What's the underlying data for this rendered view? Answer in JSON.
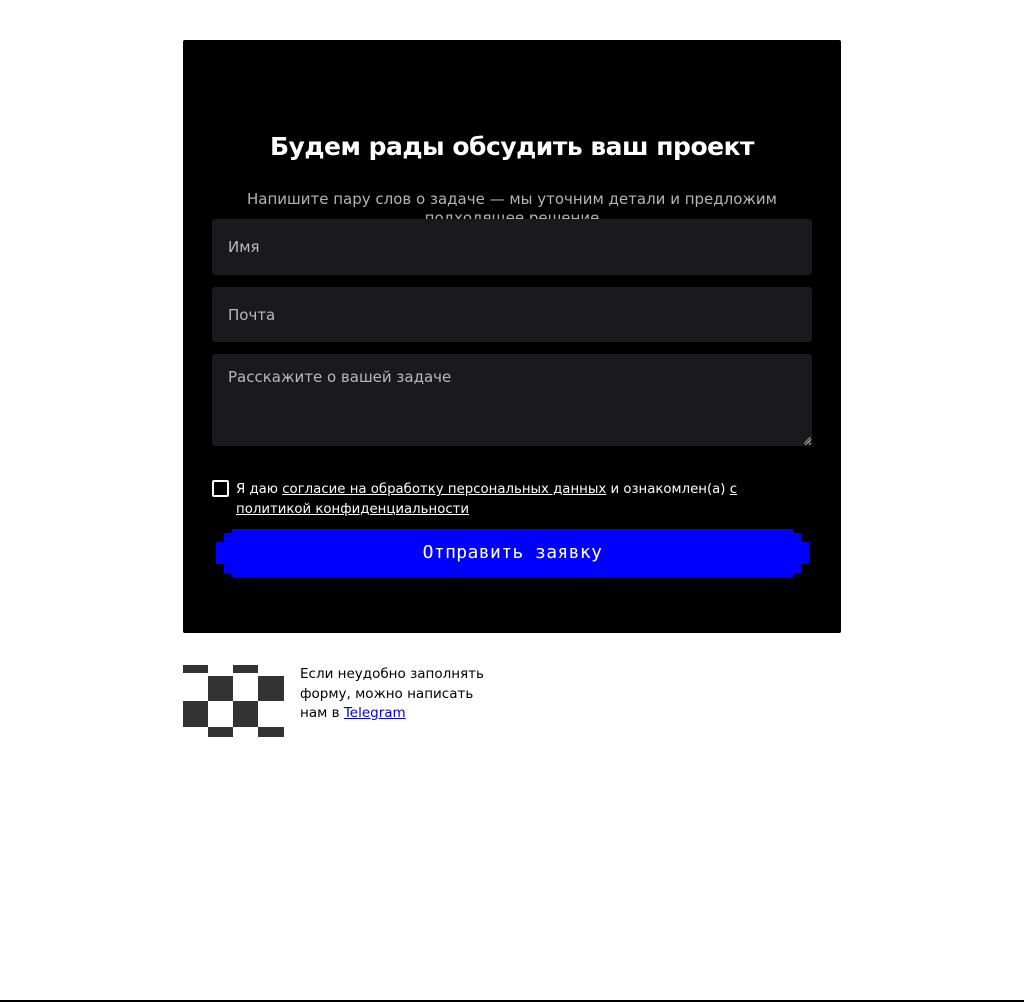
{
  "form": {
    "title": "Будем рады обсудить ваш проект",
    "subtitle": "Напишите пару слов о задаче — мы уточним детали и предложим подходящее решение",
    "name_placeholder": "Имя",
    "email_placeholder": "Почта",
    "message_placeholder": "Расскажите о вашей задаче",
    "consent": {
      "prefix": "Я даю",
      "consent_link": "согласие на обработку персональных данных",
      "middle": "и ознакомлен(а)",
      "policy_link": "с политикой конфиденциальности",
      "checked": false
    },
    "submit_label": "Отправить заявку",
    "colors": {
      "card_bg": "#000000",
      "field_bg": "#1a1a1d",
      "submit_bg": "#0000ff"
    }
  },
  "alt_contact": {
    "text_before": "Если неудобно заполнять форму, можно написать нам в",
    "link_label": "Telegram",
    "icon": "checker-pattern-icon"
  }
}
